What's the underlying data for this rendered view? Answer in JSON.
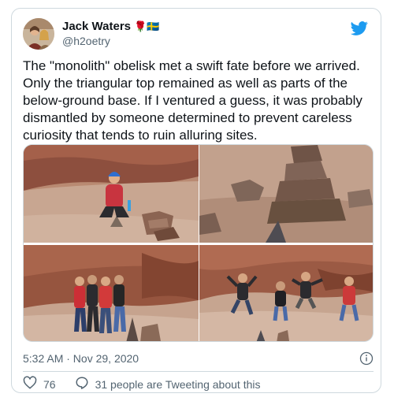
{
  "tweet": {
    "author": {
      "display_name": "Jack Waters",
      "emoji": "🌹🇸🇪",
      "handle": "@h2oetry"
    },
    "text": "The \"monolith\" obelisk met a swift fate before we arrived. Only the triangular top remained as well as parts of the below-ground base. If I ventured a guess, it was probably dismantled by someone determined to prevent careless curiosity that tends to ruin alluring sites.",
    "timestamp": "5:32 AM · Nov 29, 2020",
    "likes": "76",
    "conversation": "31 people are Tweeting about this"
  },
  "colors": {
    "twitter_blue": "#1d9bf0",
    "secondary_text": "#536471",
    "border": "#cfd9de"
  },
  "icons": {
    "brand": "twitter-bird-icon",
    "info": "info-icon",
    "like": "heart-icon",
    "reply": "speech-bubble-icon"
  }
}
